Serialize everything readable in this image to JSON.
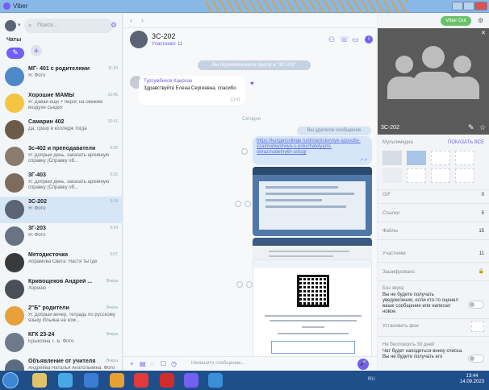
{
  "window": {
    "title": "Viber"
  },
  "left": {
    "search_placeholder": "Поиск...",
    "chats_label": "Чаты",
    "chats": [
      {
        "name": "МГ- 401 с родителями",
        "time": "11:34",
        "preview": "Я: Фото"
      },
      {
        "name": "Хорошие МАМЫ",
        "time": "10:45",
        "preview": "Я: Давай еще + пирог, на свежем воздухе съедят"
      },
      {
        "name": "Самарин 402",
        "time": "10:41",
        "preview": "Да, сразу в колледж тогда"
      },
      {
        "name": "3с-402 и преподаватели",
        "time": "9:26",
        "preview": "Я: Добрый день, заказать архивную справку (Справку об..."
      },
      {
        "name": "3Г-403",
        "time": "9:25",
        "preview": "Я: Добрый день, заказать архивную справку (Справку об..."
      },
      {
        "name": "3С-202",
        "time": "9:24",
        "preview": "Я: Фото"
      },
      {
        "name": "3Г-203",
        "time": "9:24",
        "preview": "Я: Фото"
      },
      {
        "name": "Методисточки",
        "time": "9:07",
        "preview": "Абрамова Света: Настя ты где"
      },
      {
        "name": "Кривощеков Андрей ...",
        "time": "Вчера",
        "preview": "Хорошо"
      },
      {
        "name": "2\"Б\" родители",
        "time": "Вчера",
        "preview": "Я: Добрый вечер, тетрадь по русскому языку Ильина не ком..."
      },
      {
        "name": "КГК 23-24",
        "time": "Вчера",
        "preview": "Ерыксина Т. Б: Фото"
      },
      {
        "name": "Объявление от учителя ...",
        "time": "Вчера",
        "preview": "Андреева Наталья Анатольевна: Фото"
      }
    ]
  },
  "chat": {
    "title": "3С-202",
    "subtitle": "Участники: 11",
    "system_message": "Вы переименовали группу в \"3С-202\"",
    "incoming": {
      "author": "Турсумбеков Каирхан",
      "text": "Здравствуйте Елена Сергеевна, спасибо",
      "time": "13:41"
    },
    "day_separator": "Сегодня",
    "deleted_notice": "Вы удалили сообщение",
    "link": "https://kurgancollege.ru/distantsionnye-sposoby-vzaimodeystviya-s-poluchatelyami-obrazovatelnykh-uslug/",
    "composer_placeholder": "Напишите сообщение..."
  },
  "right": {
    "viber_out": "Viber Out",
    "group_name": "3С-202",
    "media_label": "Мультимедиа",
    "show_all": "ПОКАЗАТЬ ВСЕ",
    "gif_label": "GIF",
    "gif_count": "0",
    "links_label": "Ссылки",
    "links_count": "5",
    "files_label": "Файлы",
    "files_count": "15",
    "members_label": "Участники",
    "members_count": "11",
    "encrypted_label": "Зашифровано",
    "mute_title": "Без звука",
    "mute_text": "Вы не будете получать уведомления, если кто-то оценил ваше сообщение или написал новое",
    "background_label": "Установить фон",
    "nodisturb_title": "Не беспокоить 30 дней",
    "nodisturb_text": "Чат будет находиться внизу списка. Вы не будете получать его"
  },
  "taskbar": {
    "lang": "RU",
    "time": "13:44",
    "date": "14.09.2023"
  },
  "colors": {
    "accent": "#7360f2",
    "viber_out": "#69c26b",
    "selected": "#d7e6f6"
  }
}
